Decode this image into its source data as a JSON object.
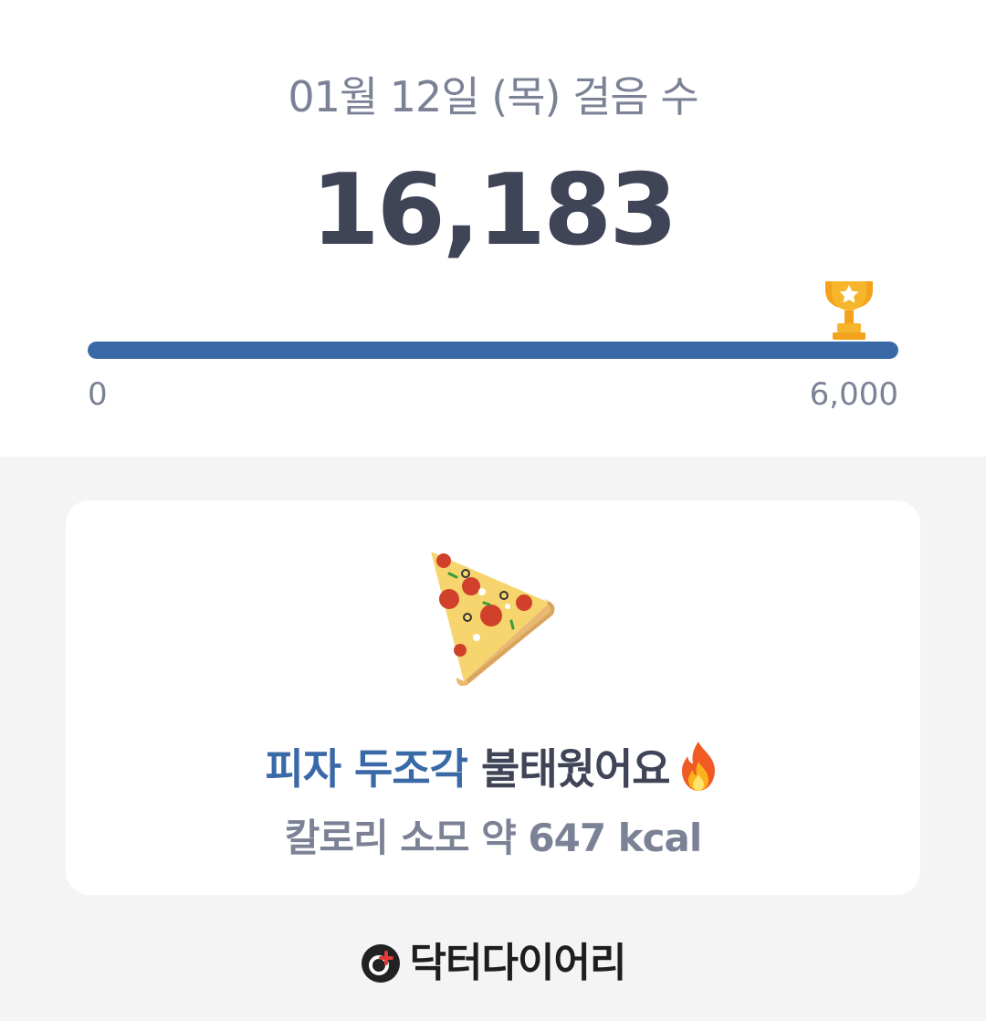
{
  "header": {
    "date_title": "01월 12일 (목) 걸음 수",
    "steps": "16,183"
  },
  "progress": {
    "value": 16183,
    "goal": 6000,
    "fill_fraction": 1.0,
    "scale_min": "0",
    "scale_max": "6,000",
    "fill_color": "#3a69a8",
    "track_color": "#e3e6ec",
    "goal_icon": "trophy-icon"
  },
  "card": {
    "food_icon": "pizza-icon",
    "headline_accent": "피자 두조각",
    "headline_rest": " 불태웠어요",
    "headline_icon": "fire-icon",
    "calorie_text": "칼로리 소모 약 647 kcal"
  },
  "footer": {
    "brand_icon": "doctor-diary-logo-icon",
    "brand_name": "닥터다이어리"
  }
}
